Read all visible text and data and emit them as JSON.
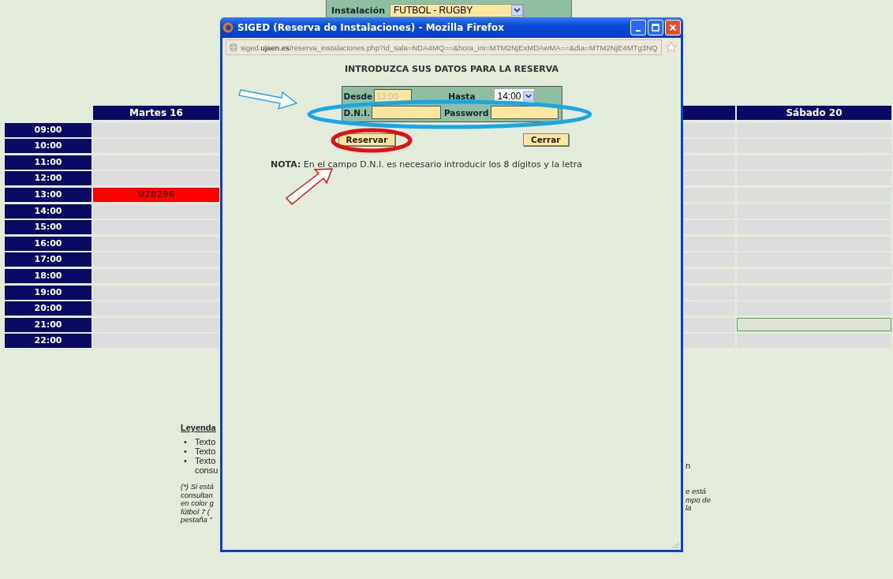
{
  "installation": {
    "label": "Instalación",
    "value": "FUTBOL - RUGBY"
  },
  "calendar": {
    "days": [
      {
        "label": "Martes 16"
      },
      {
        "label": "Sábado 20"
      }
    ],
    "rows": [
      {
        "time": "09:00",
        "cells": [
          {
            "booked": false,
            "selected": false
          },
          {
            "booked": false,
            "selected": false
          }
        ]
      },
      {
        "time": "10:00",
        "cells": [
          {
            "booked": false,
            "selected": false
          },
          {
            "booked": false,
            "selected": false
          }
        ]
      },
      {
        "time": "11:00",
        "cells": [
          {
            "booked": false,
            "selected": false
          },
          {
            "booked": false,
            "selected": false
          }
        ]
      },
      {
        "time": "12:00",
        "cells": [
          {
            "booked": false,
            "selected": false
          },
          {
            "booked": false,
            "selected": false
          }
        ]
      },
      {
        "time": "13:00",
        "cells": [
          {
            "booked": true,
            "selected": false,
            "text": "U28296"
          },
          {
            "booked": false,
            "selected": false
          }
        ]
      },
      {
        "time": "14:00",
        "cells": [
          {
            "booked": false,
            "selected": false
          },
          {
            "booked": false,
            "selected": false
          }
        ]
      },
      {
        "time": "15:00",
        "cells": [
          {
            "booked": false,
            "selected": false
          },
          {
            "booked": false,
            "selected": false
          }
        ]
      },
      {
        "time": "16:00",
        "cells": [
          {
            "booked": false,
            "selected": false
          },
          {
            "booked": false,
            "selected": false
          }
        ]
      },
      {
        "time": "17:00",
        "cells": [
          {
            "booked": false,
            "selected": false
          },
          {
            "booked": false,
            "selected": false
          }
        ]
      },
      {
        "time": "18:00",
        "cells": [
          {
            "booked": false,
            "selected": false
          },
          {
            "booked": false,
            "selected": false
          }
        ]
      },
      {
        "time": "19:00",
        "cells": [
          {
            "booked": false,
            "selected": false
          },
          {
            "booked": false,
            "selected": false
          }
        ]
      },
      {
        "time": "20:00",
        "cells": [
          {
            "booked": false,
            "selected": false
          },
          {
            "booked": false,
            "selected": false
          }
        ]
      },
      {
        "time": "21:00",
        "cells": [
          {
            "booked": false,
            "selected": false
          },
          {
            "booked": false,
            "selected": true
          }
        ]
      },
      {
        "time": "22:00",
        "cells": [
          {
            "booked": false,
            "selected": false
          },
          {
            "booked": false,
            "selected": false
          }
        ]
      }
    ]
  },
  "legend": {
    "title": "Leyenda",
    "marker": "•",
    "items": [
      "Texto",
      "Texto",
      "Texto"
    ],
    "item_continuation": "consu",
    "note_lines": [
      "(*) Si está",
      "consultan",
      "en color g",
      "fútbol 7 (",
      "pestaña \""
    ],
    "right_fragments": [
      "n"
    ],
    "right_note_lines": [
      "e está",
      "mpo de",
      "la"
    ]
  },
  "popup": {
    "title": "SIGED (Reserva de Instalaciones) - Mozilla Firefox",
    "url": {
      "host_prefix": "siged.",
      "host": "ujaen.es",
      "path": "/reserva_instalaciones.php?id_sala=NDA4MQ==&hora_ini=MTM2NjExMDAwMA==&dia=MTM2NjE4MTg3NQ"
    },
    "heading": "INTRODUZCA SUS DATOS PARA LA RESERVA",
    "form": {
      "desde": {
        "label": "Desde",
        "value": "13:00",
        "disabled": true
      },
      "hasta": {
        "label": "Hasta",
        "value": "14:00"
      },
      "dni": {
        "label": "D.N.I."
      },
      "password": {
        "label": "Password"
      }
    },
    "buttons": [
      "Reservar",
      "Cerrar"
    ],
    "note": "**NOTA:** En el campo D.N.I. es necesario introducir los 8 dígitos y la letra"
  }
}
